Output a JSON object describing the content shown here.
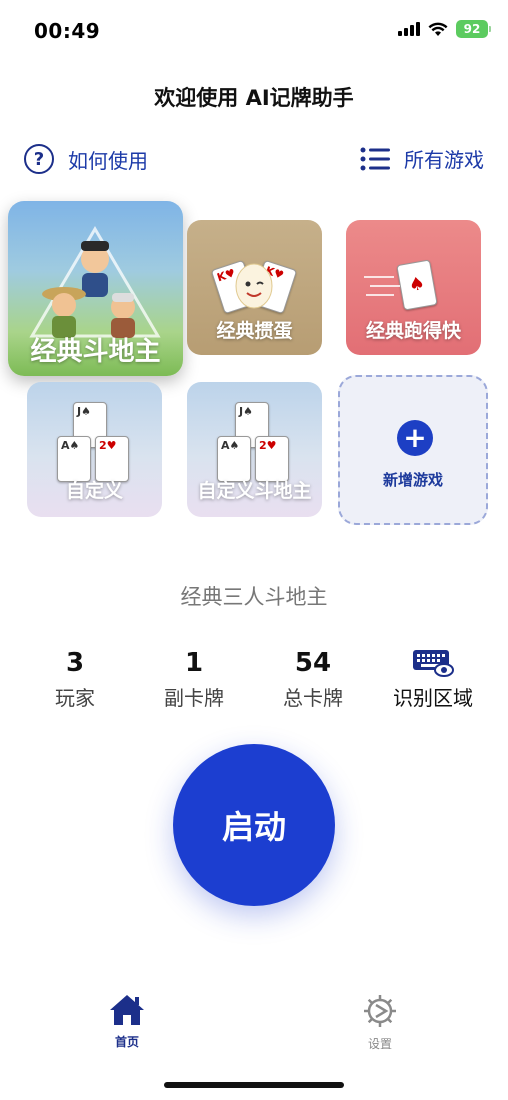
{
  "status_bar": {
    "time": "00:49",
    "battery": "92"
  },
  "header": {
    "title": "欢迎使用 AI记牌助手"
  },
  "links": {
    "help": "如何使用",
    "all_games": "所有游戏"
  },
  "games": [
    {
      "label": "经典斗地主",
      "selected": true
    },
    {
      "label": "经典掼蛋"
    },
    {
      "label": "经典跑得快"
    },
    {
      "label": "自定义"
    },
    {
      "label": "自定义斗地主"
    }
  ],
  "add_game": {
    "label": "新增游戏"
  },
  "selected_game": "经典三人斗地主",
  "stats": {
    "players": {
      "value": "3",
      "label": "玩家"
    },
    "sub_cards": {
      "value": "1",
      "label": "副卡牌"
    },
    "total_cards": {
      "value": "54",
      "label": "总卡牌"
    },
    "region": {
      "label": "识别区域"
    }
  },
  "start_button": "启动",
  "tabs": [
    {
      "label": "首页",
      "active": true
    },
    {
      "label": "设置"
    }
  ],
  "colors": {
    "primary": "#1c3ed0",
    "link": "#1c3aa8",
    "battery": "#5ccb5f"
  }
}
